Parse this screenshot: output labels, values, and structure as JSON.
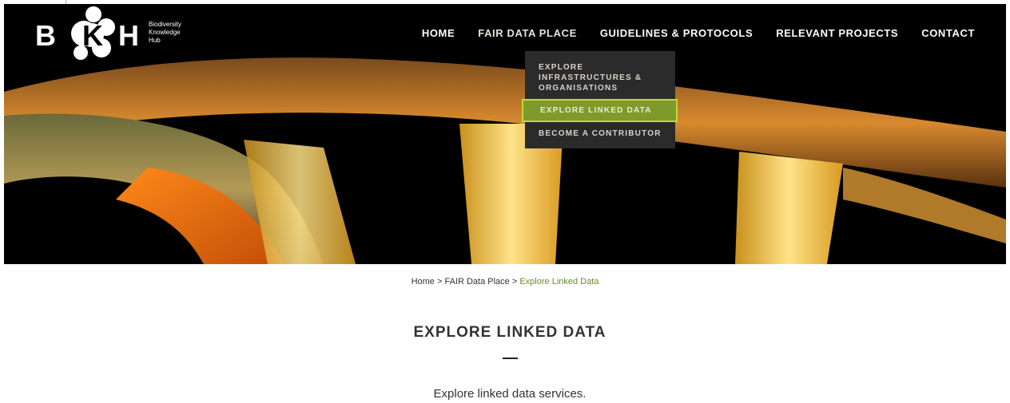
{
  "brand": {
    "letters": [
      "B",
      "K",
      "H"
    ],
    "tagline_lines": [
      "Biodiversity",
      "Knowledge",
      "Hub"
    ]
  },
  "nav": {
    "items": [
      {
        "label": "HOME"
      },
      {
        "label": "FAIR DATA PLACE",
        "active": true
      },
      {
        "label": "GUIDELINES & PROTOCOLS"
      },
      {
        "label": "RELEVANT PROJECTS"
      },
      {
        "label": "CONTACT"
      }
    ]
  },
  "dropdown": {
    "items": [
      {
        "label_lines": [
          "EXPLORE",
          "INFRASTRUCTURES &",
          "ORGANISATIONS"
        ]
      },
      {
        "label": "EXPLORE LINKED DATA",
        "highlighted": true
      },
      {
        "label": "BECOME A CONTRIBUTOR"
      }
    ]
  },
  "breadcrumb": {
    "home": "Home",
    "sep1": " > ",
    "section": "FAIR Data Place",
    "sep2": " > ",
    "current": "Explore Linked Data"
  },
  "page": {
    "title": "EXPLORE LINKED DATA",
    "intro": "Explore linked data services."
  },
  "colors": {
    "accent_green": "#6b8a32",
    "highlight_border": "#c1d93c",
    "dropdown_bg": "#2b2b2b"
  }
}
